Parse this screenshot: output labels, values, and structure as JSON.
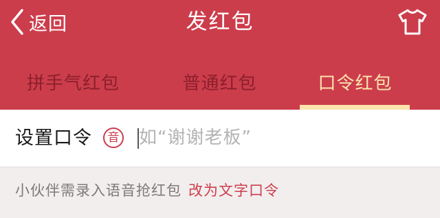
{
  "nav": {
    "back_label": "返回",
    "title": "发红包",
    "right_icon": "tshirt-icon"
  },
  "tabs": [
    {
      "label": "拼手气红包",
      "active": false
    },
    {
      "label": "普通红包",
      "active": false
    },
    {
      "label": "口令红包",
      "active": true
    }
  ],
  "passphrase": {
    "label": "设置口令",
    "voice_badge": "音",
    "placeholder": "如“谢谢老板”",
    "value": ""
  },
  "hint": {
    "text": "小伙伴需录入语音抢红包",
    "link": "改为文字口令"
  },
  "colors": {
    "header_bg": "#cc3d4c",
    "tab_active": "#fbe3ad",
    "tab_inactive": "#8c1f2c",
    "link": "#cc3d4c",
    "page_bg": "#f2eeee"
  }
}
